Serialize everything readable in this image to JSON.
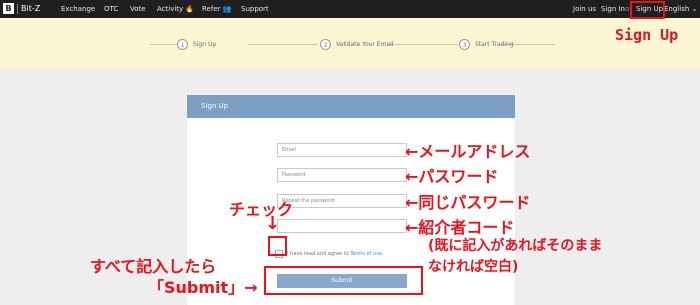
{
  "brand": {
    "logo_letter": "B",
    "name": "Bit-Z"
  },
  "nav": {
    "items": [
      "Exchange",
      "OTC",
      "Vote",
      "Activity",
      "Refer",
      "Support"
    ],
    "join": "Join us",
    "sign_in": "Sign In",
    "or": "or",
    "sign_up": "Sign Up",
    "language": "English"
  },
  "steps": [
    {
      "num": "1",
      "label": "Sign Up"
    },
    {
      "num": "2",
      "label": "Validate Your Email"
    },
    {
      "num": "3",
      "label": "Start Trading"
    }
  ],
  "form": {
    "title": "Sign Up",
    "email_placeholder": "Email",
    "password_placeholder": "Password",
    "repeat_placeholder": "Repeat the password",
    "referral_placeholder": "",
    "agree_text": "I have read and agree to",
    "terms_link": "Terms of use.",
    "submit": "Submit"
  },
  "annotations": {
    "sign_up": "Sign Up",
    "email": "←メールアドレス",
    "password": "←パスワード",
    "repeat": "←同じパスワード",
    "referral": "←紹介者コード",
    "referral_note1": "(既に記入があればそのまま",
    "referral_note2": "なければ空白)",
    "check": "チェック",
    "check_arrow": "↓",
    "all_filled": "すべて記入したら",
    "submit_note": "「Submit」→"
  },
  "colors": {
    "accent": "#e8131f",
    "header": "#7d9fc6",
    "band": "#fdf6d2",
    "nav": "#1f1f1f",
    "activity_icon": "#ff6a2a"
  }
}
